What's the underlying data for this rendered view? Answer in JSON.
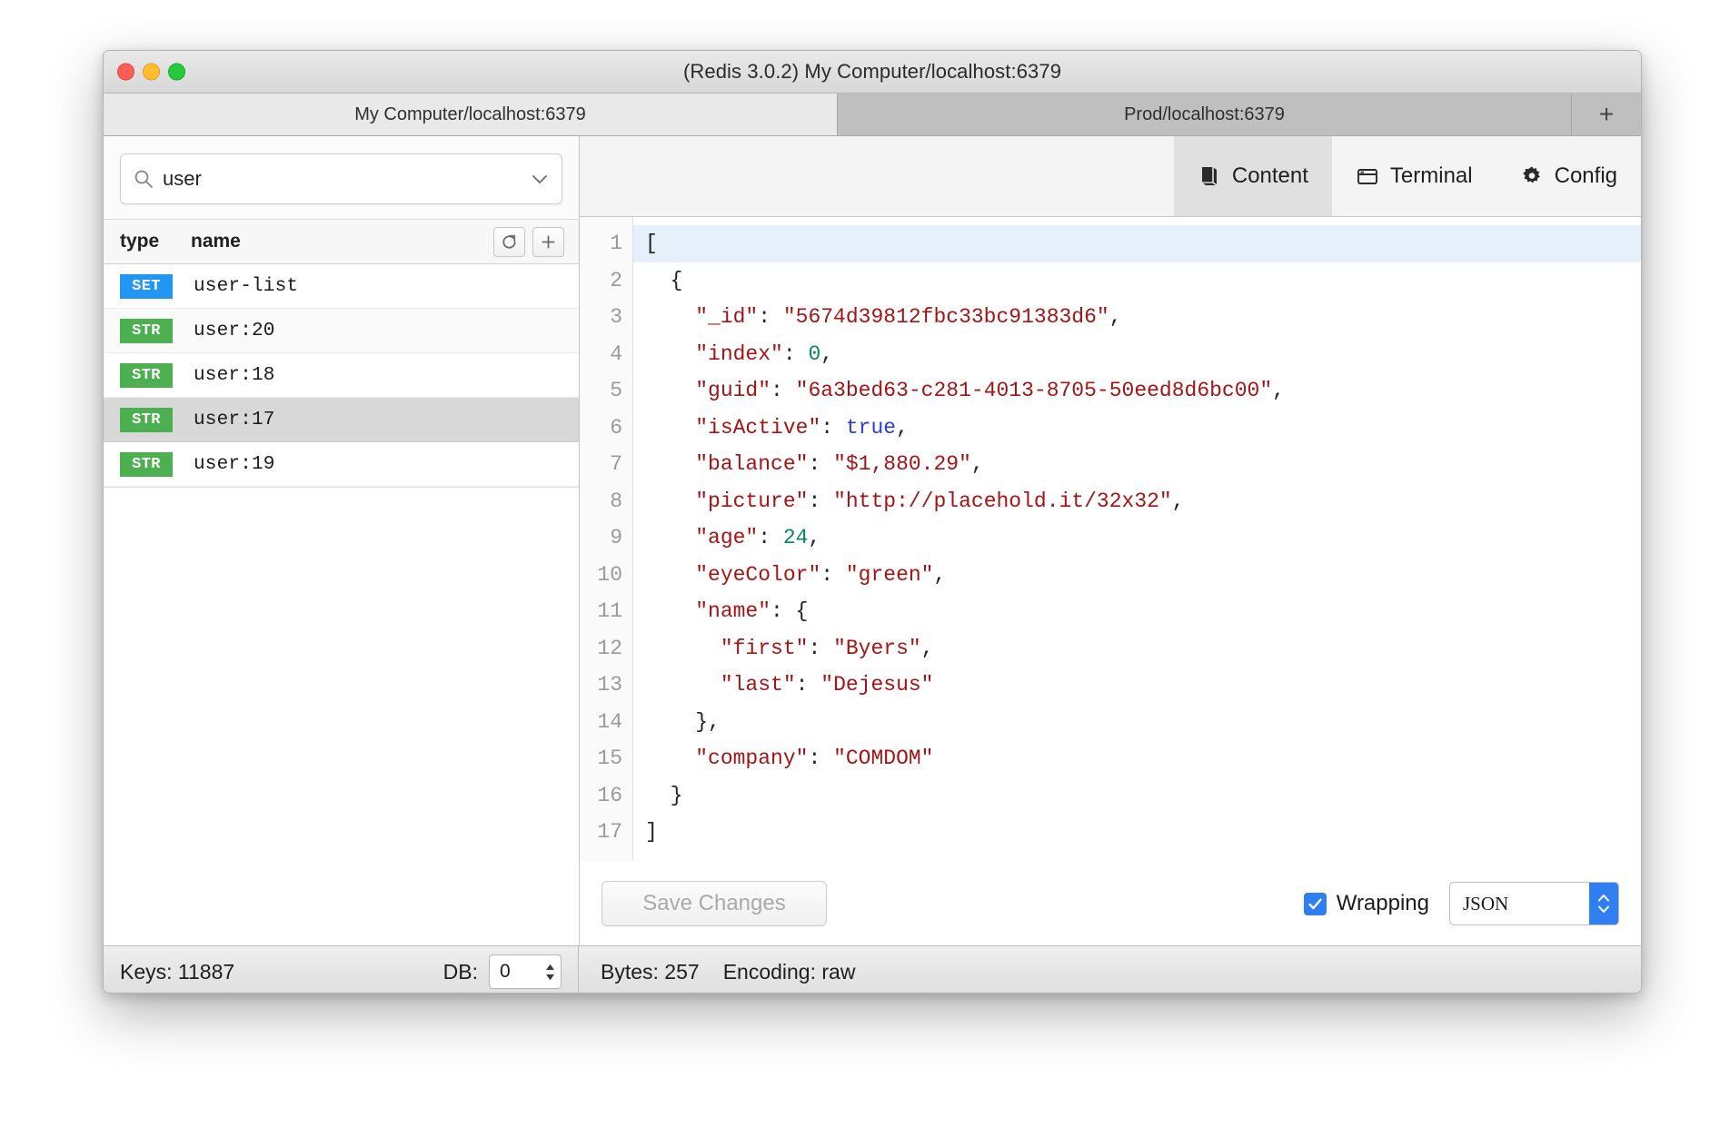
{
  "window": {
    "title": "(Redis 3.0.2) My Computer/localhost:6379",
    "traffic": {
      "close": "close-button",
      "minimize": "minimize-button",
      "maximize": "maximize-button"
    }
  },
  "connection_tabs": {
    "tabs": [
      {
        "label": "My Computer/localhost:6379",
        "active": true
      },
      {
        "label": "Prod/localhost:6379",
        "active": false
      }
    ],
    "add_label": "+"
  },
  "sidebar": {
    "search": {
      "value": "user",
      "placeholder": "Search keys"
    },
    "columns": {
      "type": "type",
      "name": "name"
    },
    "buttons": {
      "refresh": "refresh-keys-button",
      "add": "+"
    },
    "keys": [
      {
        "type": "SET",
        "name": "user-list",
        "color": "#2196f3",
        "selected": false
      },
      {
        "type": "STR",
        "name": "user:20",
        "color": "#4caf50",
        "selected": false
      },
      {
        "type": "STR",
        "name": "user:18",
        "color": "#4caf50",
        "selected": false
      },
      {
        "type": "STR",
        "name": "user:17",
        "color": "#4caf50",
        "selected": true
      },
      {
        "type": "STR",
        "name": "user:19",
        "color": "#4caf50",
        "selected": false
      }
    ]
  },
  "view_tabs": [
    {
      "label": "Content",
      "icon": "book-icon",
      "active": true
    },
    {
      "label": "Terminal",
      "icon": "window-icon",
      "active": false
    },
    {
      "label": "Config",
      "icon": "gear-icon",
      "active": false
    }
  ],
  "editor": {
    "lines": [
      {
        "n": "1",
        "text": "[",
        "highlight": true
      },
      {
        "n": "2",
        "text": "  {",
        "highlight": false
      },
      {
        "n": "3",
        "text": "    \"_id\": \"5674d39812fbc33bc91383d6\",",
        "highlight": false
      },
      {
        "n": "4",
        "text": "    \"index\": 0,",
        "highlight": false
      },
      {
        "n": "5",
        "text": "    \"guid\": \"6a3bed63-c281-4013-8705-50eed8d6bc00\",",
        "highlight": false
      },
      {
        "n": "6",
        "text": "    \"isActive\": true,",
        "highlight": false
      },
      {
        "n": "7",
        "text": "    \"balance\": \"$1,880.29\",",
        "highlight": false
      },
      {
        "n": "8",
        "text": "    \"picture\": \"http://placehold.it/32x32\",",
        "highlight": false
      },
      {
        "n": "9",
        "text": "    \"age\": 24,",
        "highlight": false
      },
      {
        "n": "10",
        "text": "    \"eyeColor\": \"green\",",
        "highlight": false
      },
      {
        "n": "11",
        "text": "    \"name\": {",
        "highlight": false
      },
      {
        "n": "12",
        "text": "      \"first\": \"Byers\",",
        "highlight": false
      },
      {
        "n": "13",
        "text": "      \"last\": \"Dejesus\"",
        "highlight": false
      },
      {
        "n": "14",
        "text": "    },",
        "highlight": false
      },
      {
        "n": "15",
        "text": "    \"company\": \"COMDOM\"",
        "highlight": false
      },
      {
        "n": "16",
        "text": "  }",
        "highlight": false
      },
      {
        "n": "17",
        "text": "]",
        "highlight": false
      }
    ],
    "colors": {
      "string": "#a31515",
      "number": "#098658",
      "boolean": "#2b3fd4",
      "highlight_row": "#e6f0fb"
    }
  },
  "editor_footer": {
    "save_label": "Save Changes",
    "save_enabled": false,
    "wrapping_label": "Wrapping",
    "wrapping_checked": true,
    "format_value": "JSON",
    "accent": "#2f7ff0"
  },
  "statusbar": {
    "keys_label": "Keys: 11887",
    "db_label": "DB:",
    "db_value": "0",
    "bytes_label": "Bytes: 257",
    "encoding_label": "Encoding: raw"
  }
}
